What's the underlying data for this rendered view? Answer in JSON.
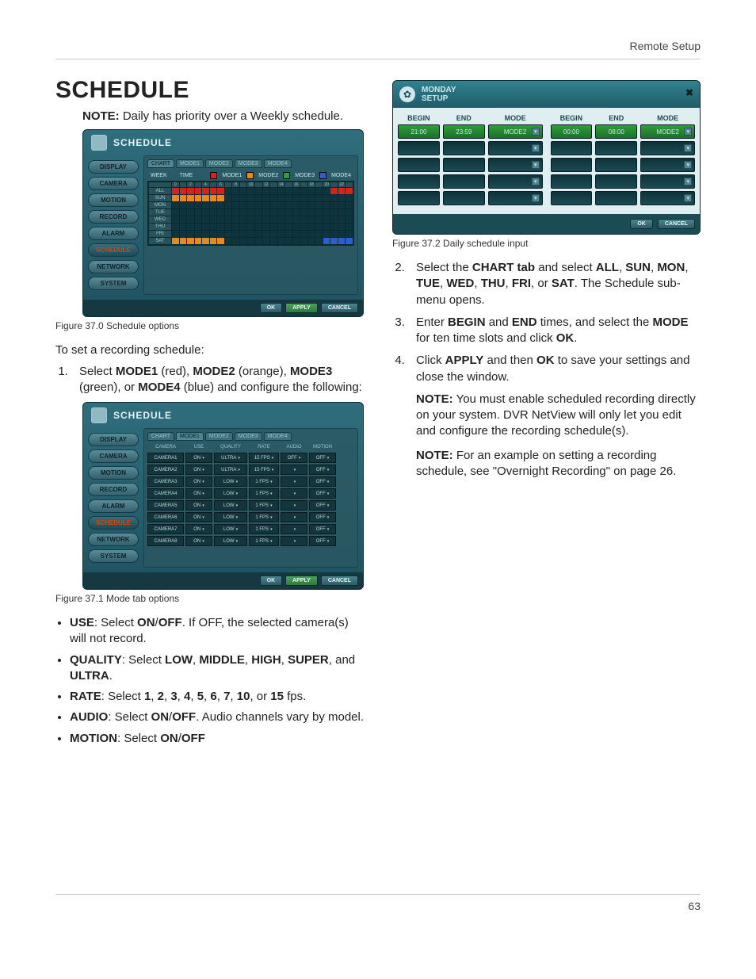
{
  "header_right": "Remote Setup",
  "page_number": "63",
  "title": "SCHEDULE",
  "note_intro": "NOTE:",
  "note_text": " Daily has priority over a Weekly schedule.",
  "sidebar_items": [
    "DISPLAY",
    "CAMERA",
    "MOTION",
    "RECORD",
    "ALARM",
    "SCHEDULE",
    "NETWORK",
    "SYSTEM"
  ],
  "tabs_chart": [
    "CHART",
    "MODE1",
    "MODE2",
    "MODE3",
    "MODE4"
  ],
  "legend": {
    "week": "WEEK",
    "time": "TIME",
    "m1": "MODE1",
    "m2": "MODE2",
    "m3": "MODE3",
    "m4": "MODE4"
  },
  "buttons": {
    "ok": "OK",
    "apply": "APPLY",
    "cancel": "CANCEL"
  },
  "caption1": "Figure 37.0 Schedule options",
  "caption2": "Figure 37.1 Mode tab options",
  "caption3": "Figure 37.2 Daily schedule input",
  "intro2": "To set a recording schedule:",
  "step1_a": "Select ",
  "step1_b": "MODE1",
  "step1_c": " (red), ",
  "step1_d": "MODE2",
  "step1_e": " (orange), ",
  "step1_f": "MODE3",
  "step1_g": " (green), or ",
  "step1_h": "MODE4",
  "step1_i": " (blue) and configure the following:",
  "mode_headers": [
    "CAMERA",
    "USE",
    "QUALITY",
    "RATE",
    "AUDIO",
    "MOTION"
  ],
  "mode_rows": [
    {
      "cam": "CAMERA1",
      "use": "ON",
      "q": "ULTRA",
      "r": "15 FPS",
      "a": "OFF",
      "m": "OFF"
    },
    {
      "cam": "CAMERA2",
      "use": "ON",
      "q": "ULTRA",
      "r": "15 FPS",
      "a": "",
      "m": "OFF"
    },
    {
      "cam": "CAMERA3",
      "use": "ON",
      "q": "LOW",
      "r": "1 FPS",
      "a": "",
      "m": "OFF"
    },
    {
      "cam": "CAMERA4",
      "use": "ON",
      "q": "LOW",
      "r": "1 FPS",
      "a": "",
      "m": "OFF"
    },
    {
      "cam": "CAMERA5",
      "use": "ON",
      "q": "LOW",
      "r": "1 FPS",
      "a": "",
      "m": "OFF"
    },
    {
      "cam": "CAMERA6",
      "use": "ON",
      "q": "LOW",
      "r": "1 FPS",
      "a": "",
      "m": "OFF"
    },
    {
      "cam": "CAMERA7",
      "use": "ON",
      "q": "LOW",
      "r": "1 FPS",
      "a": "",
      "m": "OFF"
    },
    {
      "cam": "CAMERA8",
      "use": "ON",
      "q": "LOW",
      "r": "1 FPS",
      "a": "",
      "m": "OFF"
    }
  ],
  "bul1a": "USE",
  "bul1b": ": Select ",
  "bul1c": "ON",
  "bul1d": "/",
  "bul1e": "OFF",
  "bul1f": ". If OFF, the selected camera(s) will not record.",
  "bul2a": "QUALITY",
  "bul2b": ": Select ",
  "bul2c": "LOW",
  "bul2d": ", ",
  "bul2e": "MIDDLE",
  "bul2f": ", ",
  "bul2g": "HIGH",
  "bul2h": ", ",
  "bul2i": "SUPER",
  "bul2j": ", and ",
  "bul2k": "ULTRA",
  "bul2l": ".",
  "bul3a": "RATE",
  "bul3b": ": Select ",
  "bul3c": "1",
  "bul3d": ", ",
  "bul3e": "2",
  "bul3f": ", ",
  "bul3g": "3",
  "bul3h": ", ",
  "bul3i": "4",
  "bul3j": ", ",
  "bul3k": "5",
  "bul3l": ", ",
  "bul3m": "6",
  "bul3n": ", ",
  "bul3o": "7",
  "bul3p": ", ",
  "bul3q": "10",
  "bul3r": ", or ",
  "bul3s": "15",
  "bul3t": " fps.",
  "bul4a": "AUDIO",
  "bul4b": ": Select ",
  "bul4c": "ON",
  "bul4d": "/",
  "bul4e": "OFF",
  "bul4f": ". Audio channels vary by model.",
  "bul5a": "MOTION",
  "bul5b": ": Select ",
  "bul5c": "ON",
  "bul5d": "/",
  "bul5e": "OFF",
  "msetup_title": "MONDAY\nSETUP",
  "ms_headers": [
    "BEGIN",
    "END",
    "MODE"
  ],
  "ms_left": [
    {
      "b": "21:00",
      "e": "23:59",
      "m": "MODE2"
    }
  ],
  "ms_right": [
    {
      "b": "00:00",
      "e": "08:00",
      "m": "MODE2"
    }
  ],
  "step2a": "Select the ",
  "step2b": "CHART tab",
  "step2c": " and select ",
  "step2d": "ALL",
  "step2e": ", ",
  "step2f": "SUN",
  "step2g": ", ",
  "step2h": "MON",
  "step2i": ", ",
  "step2j": "TUE",
  "step2k": ", ",
  "step2l": "WED",
  "step2m": ", ",
  "step2n": "THU",
  "step2o": ", ",
  "step2p": "FRI",
  "step2q": ", or ",
  "step2r": "SAT",
  "step2s": ". The Schedule sub-menu opens.",
  "step3a": "Enter ",
  "step3b": "BEGIN",
  "step3c": " and ",
  "step3d": "END",
  "step3e": " times, and select the ",
  "step3f": "MODE",
  "step3g": " for ten time slots and click ",
  "step3h": "OK",
  "step3i": ".",
  "step4a": "Click ",
  "step4b": "APPLY",
  "step4c": " and then ",
  "step4d": "OK",
  "step4e": " to save your settings and close the window.",
  "note2a": "NOTE:",
  "note2b": " You must enable scheduled recording directly on your system. DVR NetView will only let you edit and configure the recording schedule(s).",
  "note3a": "NOTE:",
  "note3b": " For an example on setting a recording schedule, see \"Overnight Recording\" on page 26.",
  "chart_data": {
    "type": "table",
    "title": "Weekly schedule timeline",
    "hours": [
      0,
      2,
      4,
      6,
      8,
      10,
      12,
      14,
      16,
      18,
      20,
      22
    ],
    "days": [
      "ALL",
      "SUN",
      "MON",
      "TUE",
      "WED",
      "THU",
      "FRI",
      "SAT"
    ],
    "series": [
      {
        "day": "ALL",
        "segments": [
          {
            "from": 0,
            "to": 7,
            "mode": "MODE1"
          },
          {
            "from": 21,
            "to": 24,
            "mode": "MODE1"
          }
        ]
      },
      {
        "day": "SUN",
        "segments": [
          {
            "from": 0,
            "to": 7,
            "mode": "MODE2"
          }
        ]
      },
      {
        "day": "MON",
        "segments": []
      },
      {
        "day": "TUE",
        "segments": []
      },
      {
        "day": "WED",
        "segments": []
      },
      {
        "day": "THU",
        "segments": []
      },
      {
        "day": "FRI",
        "segments": []
      },
      {
        "day": "SAT",
        "segments": [
          {
            "from": 0,
            "to": 7,
            "mode": "MODE2"
          },
          {
            "from": 20,
            "to": 24,
            "mode": "MODE4"
          }
        ]
      }
    ],
    "mode_colors": {
      "MODE1": "#d0261e",
      "MODE2": "#e88a1e",
      "MODE3": "#2e9e3a",
      "MODE4": "#2a5fd0"
    }
  }
}
